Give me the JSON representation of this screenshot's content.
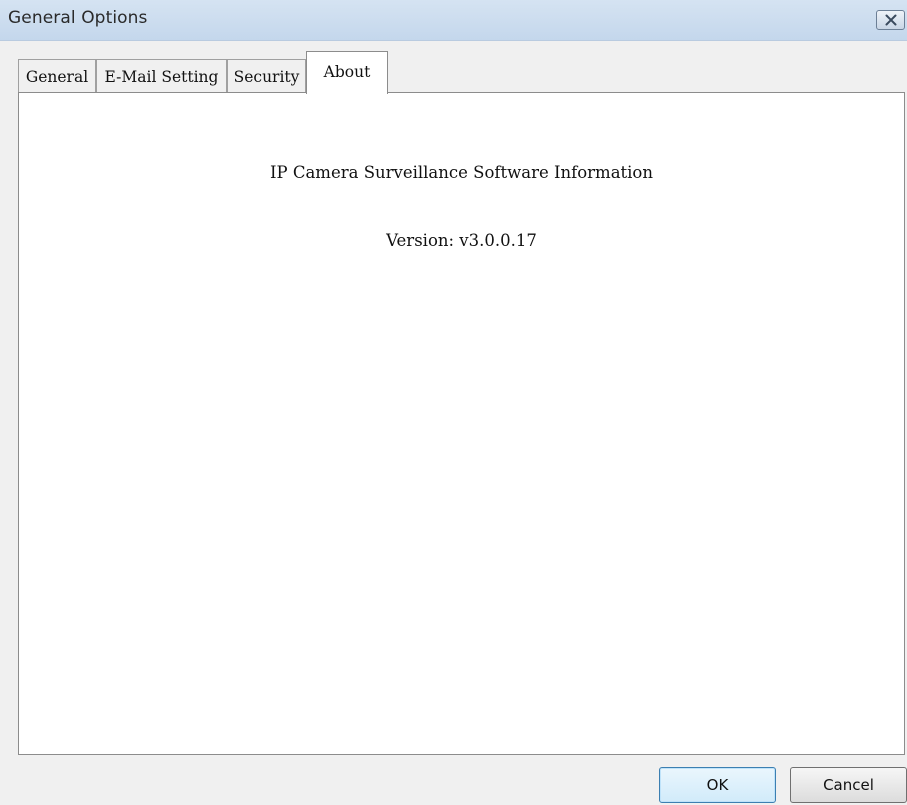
{
  "window": {
    "title": "General Options",
    "close_icon": "close-icon"
  },
  "tabs": [
    {
      "label": "General",
      "active": false
    },
    {
      "label": "E-Mail Setting",
      "active": false
    },
    {
      "label": "Security",
      "active": false
    },
    {
      "label": "About",
      "active": true
    }
  ],
  "about": {
    "info_title": "IP Camera Surveillance Software Information",
    "version": "Version: v3.0.0.17"
  },
  "buttons": {
    "ok_label": "OK",
    "cancel_label": "Cancel"
  }
}
